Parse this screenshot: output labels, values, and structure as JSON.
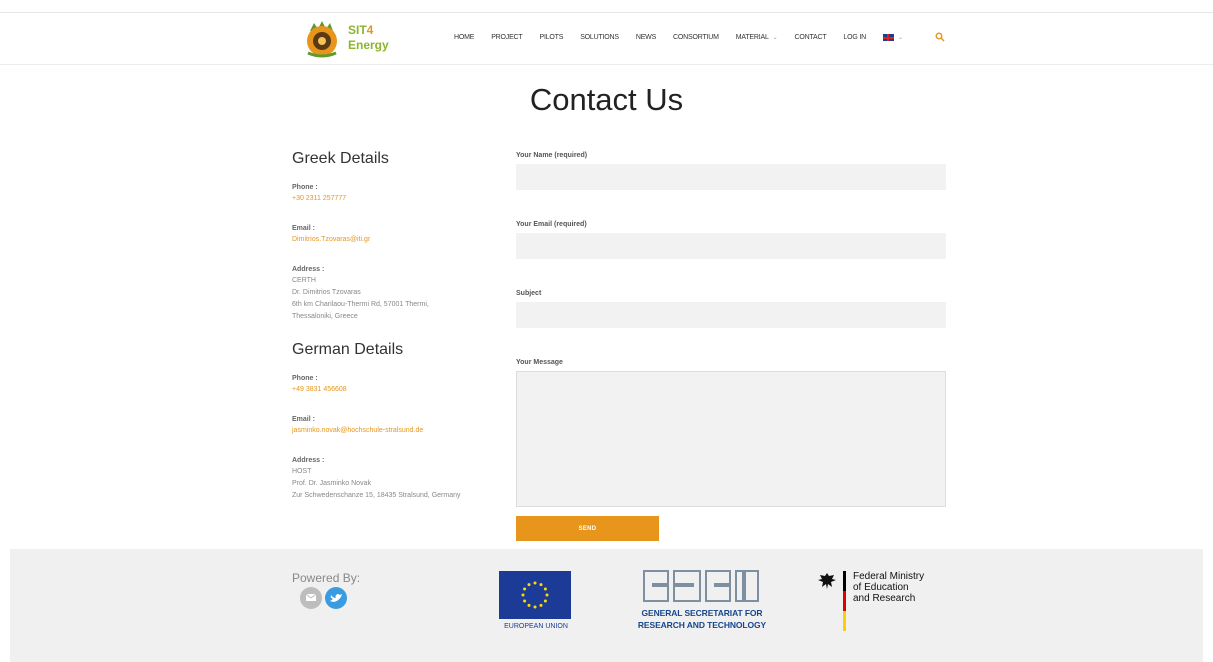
{
  "brand": {
    "line1": "SIT",
    "line1_accent": "4",
    "line2": "Energy"
  },
  "nav": [
    {
      "label": "HOME"
    },
    {
      "label": "PROJECT"
    },
    {
      "label": "PILOTS"
    },
    {
      "label": "SOLUTIONS"
    },
    {
      "label": "NEWS"
    },
    {
      "label": "CONSORTIUM"
    },
    {
      "label": "MATERIAL",
      "dropdown": true
    },
    {
      "label": "CONTACT"
    },
    {
      "label": "LOG IN"
    }
  ],
  "language": {
    "icon": "uk-flag-icon"
  },
  "page_title": "Contact Us",
  "greek": {
    "heading": "Greek Details",
    "phone_label": "Phone :",
    "phone": "+30 2311 257777",
    "email_label": "Email :",
    "email": "Dimitrios.Tzovaras@iti.gr",
    "address_label": "Address :",
    "org": "CERTH",
    "person": "Dr. Dimitrios Tzovaras",
    "street": "6th km Charilaou-Thermi Rd, 57001 Thermi,",
    "city": "Thessaloniki, Greece"
  },
  "german": {
    "heading": "German Details",
    "phone_label": "Phone :",
    "phone": "+49 3831 456608",
    "email_label": "Email :",
    "email": "jasminko.novak@hochschule-stralsund.de",
    "address_label": "Address :",
    "org": "HOST",
    "person": "Prof. Dr. Jasminko Novak",
    "street": "Zur Schwedenschanze 15, 18435 Stralsund, Germany"
  },
  "form": {
    "name_label": "Your Name (required)",
    "email_label": "Your Email (required)",
    "subject_label": "Subject",
    "message_label": "Your Message",
    "send_label": "SEND"
  },
  "footer": {
    "powered_by": "Powered By:",
    "eu_label": "EUROPEAN UNION",
    "gsrt_line1": "GENERAL SECRETARIAT FOR",
    "gsrt_line2": "RESEARCH AND TECHNOLOGY",
    "bmbf_line1": "Federal Ministry",
    "bmbf_line2": "of Education",
    "bmbf_line3": "and Research"
  },
  "colors": {
    "accent": "#e8951c",
    "brand_green": "#8bb52b",
    "eu_blue": "#1c3b96",
    "gsrt_blue": "#17468c"
  }
}
